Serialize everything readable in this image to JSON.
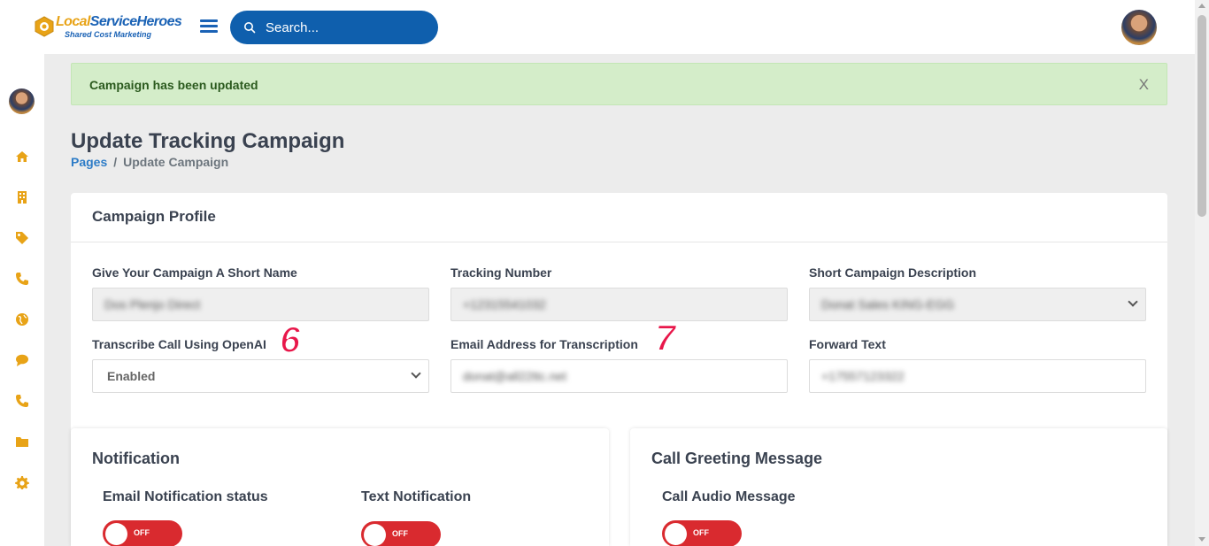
{
  "brand": {
    "name_part1": "Local",
    "name_part2": "ServiceHeroes",
    "tagline": "Shared Cost Marketing"
  },
  "search": {
    "placeholder": "Search..."
  },
  "sidebar": {
    "icons": [
      "home-icon",
      "building-icon",
      "tag-icon",
      "phone-icon",
      "globe-icon",
      "chat-icon",
      "phone-icon",
      "folder-icon",
      "gear-icon"
    ]
  },
  "alert": {
    "message": "Campaign has been updated",
    "close_label": "X"
  },
  "page": {
    "title": "Update Tracking Campaign",
    "breadcrumb": {
      "root": "Pages",
      "separator": "/",
      "current": "Update Campaign"
    }
  },
  "profile": {
    "title": "Campaign Profile",
    "fields": {
      "short_name": {
        "label": "Give Your Campaign A Short Name",
        "value": "Dos Plenjo Direct"
      },
      "tracking_number": {
        "label": "Tracking Number",
        "value": "+12315541032"
      },
      "description": {
        "label": "Short Campaign Description",
        "value": "Donat Sales KING-EGG"
      },
      "transcribe": {
        "label": "Transcribe Call Using OpenAI",
        "value": "Enabled"
      },
      "email": {
        "label": "Email Address for Transcription",
        "value": "donat@all22ttc.net"
      },
      "forward": {
        "label": "Forward Text",
        "value": "+17557123322"
      }
    },
    "annotations": [
      "6",
      "7"
    ]
  },
  "notification": {
    "title": "Notification",
    "email": {
      "label": "Email Notification status",
      "state": "OFF"
    },
    "text": {
      "label": "Text Notification",
      "state": "OFF"
    }
  },
  "greeting": {
    "title": "Call Greeting Message",
    "audio": {
      "label": "Call Audio Message",
      "state": "OFF"
    }
  },
  "colors": {
    "brand_blue": "#0f5fad",
    "brand_orange": "#e8a317",
    "toggle_off": "#d92a2f",
    "alert_bg": "#d4edc9",
    "annotation": "#e8174a"
  }
}
